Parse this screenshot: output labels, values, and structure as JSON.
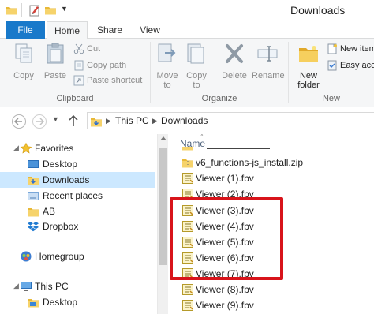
{
  "window": {
    "title": "Downloads"
  },
  "ribbon": {
    "tabs": [
      "File",
      "Home",
      "Share",
      "View"
    ],
    "clipboard": {
      "group_label": "Clipboard",
      "copy": "Copy",
      "paste": "Paste",
      "cut": "Cut",
      "copy_path": "Copy path",
      "paste_shortcut": "Paste shortcut"
    },
    "organize": {
      "group_label": "Organize",
      "move_to": "Move to",
      "copy_to": "Copy to",
      "delete": "Delete",
      "rename": "Rename"
    },
    "new": {
      "group_label": "New",
      "new_folder": "New folder",
      "new_item": "New item",
      "easy_access": "Easy acce"
    }
  },
  "address": {
    "crumbs": [
      "This PC",
      "Downloads"
    ]
  },
  "nav_pane": {
    "items": [
      {
        "label": "Favorites",
        "icon": "star-icon"
      },
      {
        "label": "Desktop",
        "icon": "desktop-icon"
      },
      {
        "label": "Downloads",
        "icon": "downloads-folder-icon"
      },
      {
        "label": "Recent places",
        "icon": "recent-places-icon"
      },
      {
        "label": "AB",
        "icon": "folder-icon"
      },
      {
        "label": "Dropbox",
        "icon": "dropbox-icon"
      },
      {
        "label": "Homegroup",
        "icon": "homegroup-icon"
      },
      {
        "label": "This PC",
        "icon": "computer-icon"
      },
      {
        "label": "Desktop",
        "icon": "desktop-icon"
      }
    ]
  },
  "file_list": {
    "column_name": "Name",
    "files": [
      {
        "name": "v6_functions-js_install.zip",
        "icon": "zip-folder-icon"
      },
      {
        "name": "Viewer (1).fbv",
        "icon": "fbv-file-icon"
      },
      {
        "name": "Viewer (2).fbv",
        "icon": "fbv-file-icon"
      },
      {
        "name": "Viewer (3).fbv",
        "icon": "fbv-file-icon"
      },
      {
        "name": "Viewer (4).fbv",
        "icon": "fbv-file-icon"
      },
      {
        "name": "Viewer (5).fbv",
        "icon": "fbv-file-icon"
      },
      {
        "name": "Viewer (6).fbv",
        "icon": "fbv-file-icon"
      },
      {
        "name": "Viewer (7).fbv",
        "icon": "fbv-file-icon"
      },
      {
        "name": "Viewer (8).fbv",
        "icon": "fbv-file-icon"
      },
      {
        "name": "Viewer (9).fbv",
        "icon": "fbv-file-icon"
      }
    ]
  },
  "colors": {
    "file_tab": "#1979ca",
    "selection": "#cce8ff",
    "highlight_box": "#d8141b",
    "folder": "#e8b938"
  }
}
